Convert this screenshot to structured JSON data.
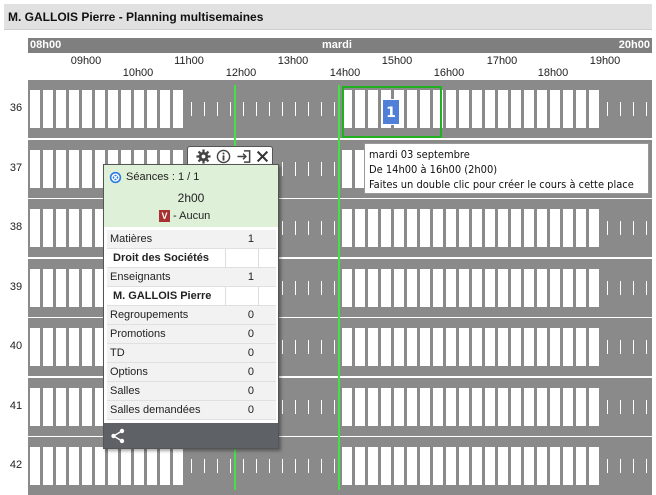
{
  "title": "M. GALLOIS Pierre - Planning multisemaines",
  "header": {
    "start": "08h00",
    "day": "mardi",
    "end": "20h00"
  },
  "hours_top": [
    "09h00",
    "11h00",
    "13h00",
    "15h00",
    "17h00",
    "19h00"
  ],
  "hours_bottom": [
    "10h00",
    "12h00",
    "14h00",
    "16h00",
    "18h00"
  ],
  "weeks": [
    "36",
    "37",
    "38",
    "39",
    "40",
    "41",
    "42"
  ],
  "selection": {
    "badge": "1"
  },
  "tooltip": {
    "line1": "mardi 03 septembre",
    "line2": "De 14h00 à 16h00 (2h00)",
    "line3": "Faites un double clic pour créer le cours à cette place"
  },
  "popup": {
    "seances": "Séances : 1 / 1",
    "duree": "2h00",
    "v_badge": "V",
    "aucun": "- Aucun",
    "rows": [
      {
        "label": "Matières",
        "count": "1"
      },
      {
        "label": "Droit des Sociétés",
        "count": ""
      },
      {
        "label": "Enseignants",
        "count": "1"
      },
      {
        "label": "M. GALLOIS Pierre",
        "count": ""
      },
      {
        "label": "Regroupements",
        "count": "0"
      },
      {
        "label": "Promotions",
        "count": "0"
      },
      {
        "label": "TD",
        "count": "0"
      },
      {
        "label": "Options",
        "count": "0"
      },
      {
        "label": "Salles",
        "count": "0"
      },
      {
        "label": "Salles demandées",
        "count": "0"
      }
    ]
  },
  "colors": {
    "accent_green": "#20b020",
    "badge_blue": "#4f7fd6",
    "v_red": "#a83232"
  }
}
